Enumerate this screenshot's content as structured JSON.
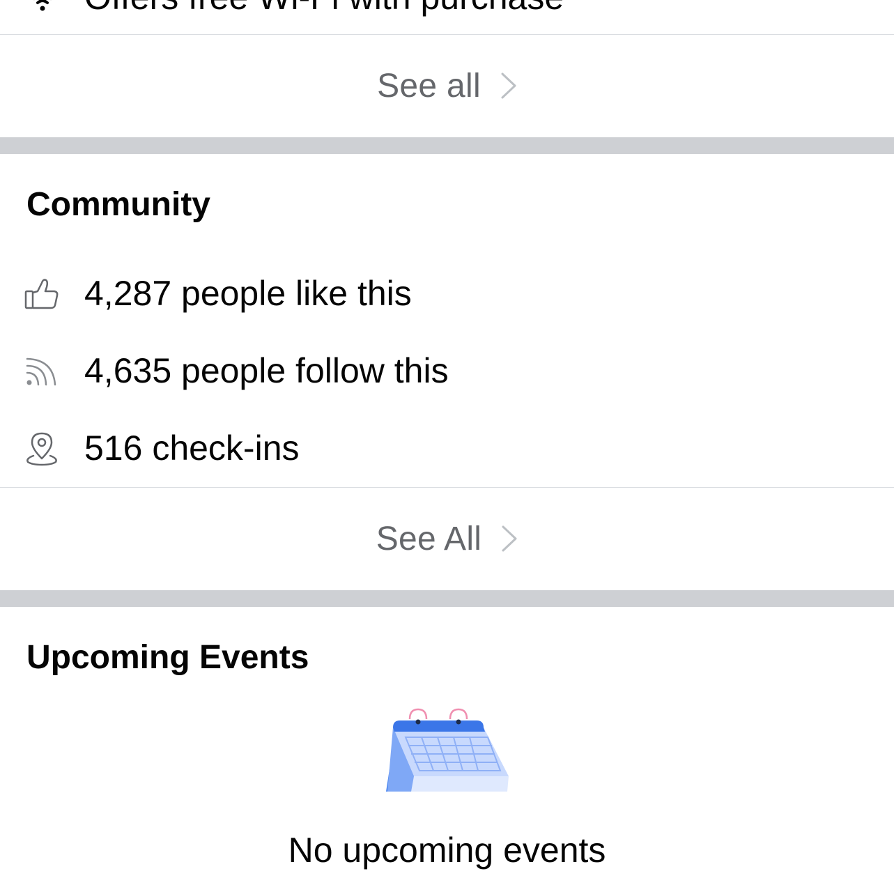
{
  "amenities": {
    "wifi_text": "Offers free Wi-Fi with purchase",
    "see_all_label": "See all"
  },
  "community": {
    "title": "Community",
    "likes_text": "4,287 people like this",
    "follows_text": "4,635 people follow this",
    "checkins_text": "516 check-ins",
    "see_all_label": "See All"
  },
  "events": {
    "title": "Upcoming Events",
    "empty_text": "No upcoming events"
  },
  "icons": {
    "wifi": "wifi-icon",
    "like": "thumbs-up-icon",
    "follow": "rss-feed-icon",
    "checkin": "location-pin-icon",
    "chevron": "chevron-right-icon",
    "calendar": "calendar-illustration"
  },
  "colors": {
    "text": "#050505",
    "secondary_text": "#65676b",
    "divider": "#dadde1",
    "section_gap": "#ced0d4",
    "calendar_blue": "#4b86f0",
    "calendar_light": "#a9c3fb",
    "calendar_rings": "#f08fb0"
  }
}
